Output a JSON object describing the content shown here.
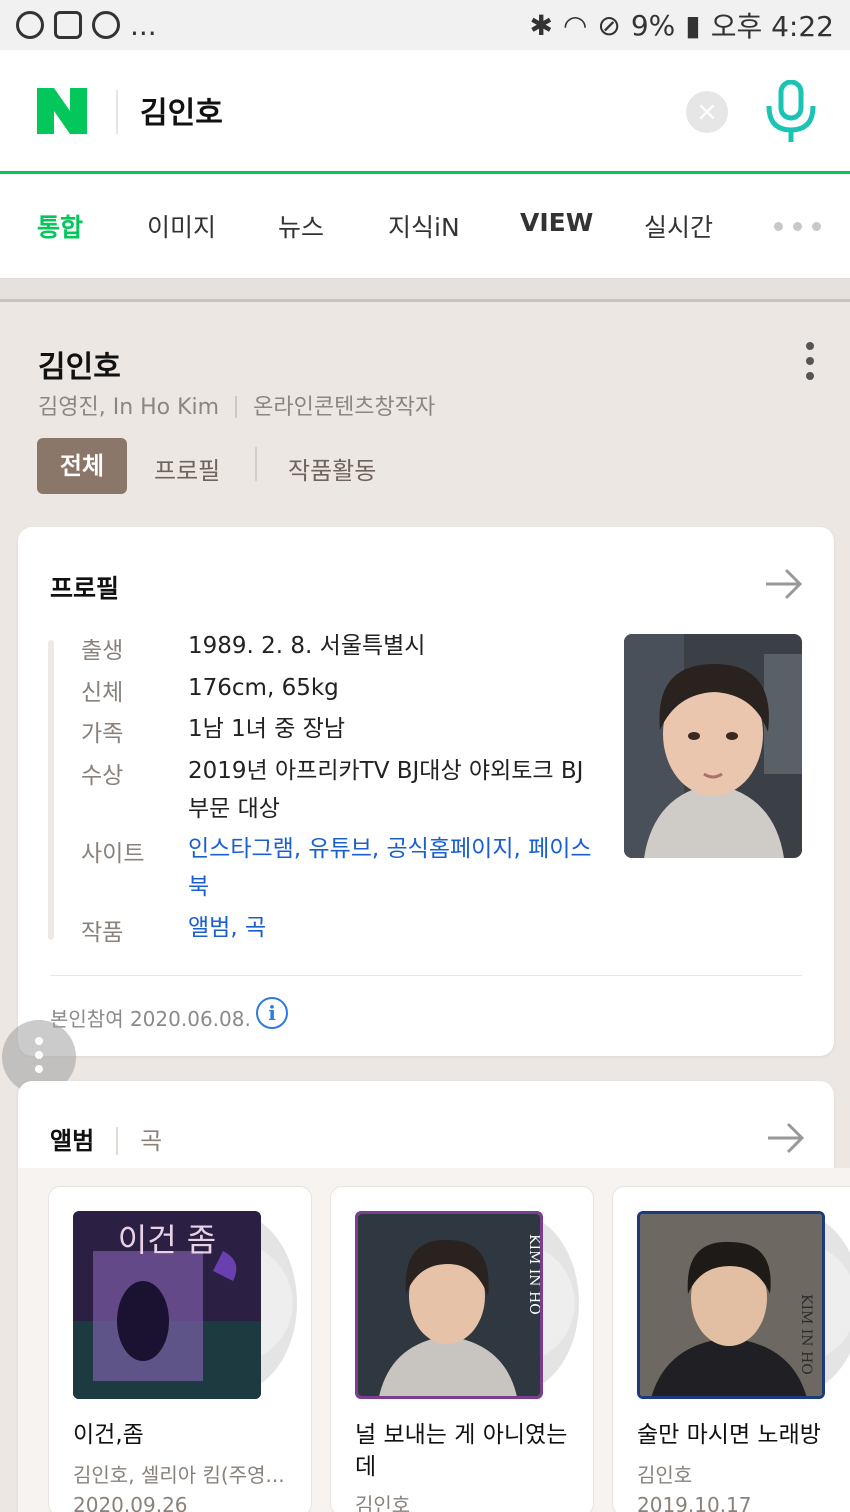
{
  "status_bar": {
    "left_extra": "...",
    "battery": "9%",
    "time": "오후 4:22"
  },
  "search": {
    "logo": "N",
    "query": "김인호",
    "clear_icon": "×"
  },
  "tabs": [
    {
      "label": "통합",
      "active": true
    },
    {
      "label": "이미지"
    },
    {
      "label": "뉴스"
    },
    {
      "label": "지식iN"
    },
    {
      "label": "VIEW"
    },
    {
      "label": "실시간"
    }
  ],
  "person": {
    "name": "김인호",
    "aliases": "김영진, In Ho Kim",
    "occupation": "온라인콘텐츠창작자",
    "segments": [
      "전체",
      "프로필",
      "작품활동"
    ]
  },
  "profile": {
    "title": "프로필",
    "rows": [
      {
        "label": "출생",
        "value": "1989. 2. 8. 서울특별시"
      },
      {
        "label": "신체",
        "value": "176cm, 65kg"
      },
      {
        "label": "가족",
        "value": "1남 1녀 중 장남"
      },
      {
        "label": "수상",
        "value": "2019년 아프리카TV BJ대상 야외토크 BJ부문 대상"
      },
      {
        "label": "사이트",
        "value": "인스타그램, 유튜브, 공식홈페이지, 페이스북"
      },
      {
        "label": "작품",
        "value": "앨범, 곡"
      }
    ],
    "self_ref": "본인참여 2020.06.08.",
    "info_icon": "i"
  },
  "albums": {
    "tabs": [
      "앨범",
      "곡"
    ],
    "items": [
      {
        "title": "이건,좀",
        "artist": "김인호, 셀리아 킴(주영...",
        "date": "2020.09.26",
        "cover_text": "이건 좀"
      },
      {
        "title": "널 보내는 게 아니였는데",
        "artist": "김인호",
        "date": "",
        "cover_text": "KIM IN HO"
      },
      {
        "title": "술만 마시면 노래방",
        "artist": "김인호",
        "date": "2019.10.17",
        "cover_text": "KIM IN HO"
      }
    ]
  },
  "colors": {
    "naver_green": "#03c75a",
    "segment_brown": "#8b7769",
    "link_blue": "#1a5fd1"
  }
}
